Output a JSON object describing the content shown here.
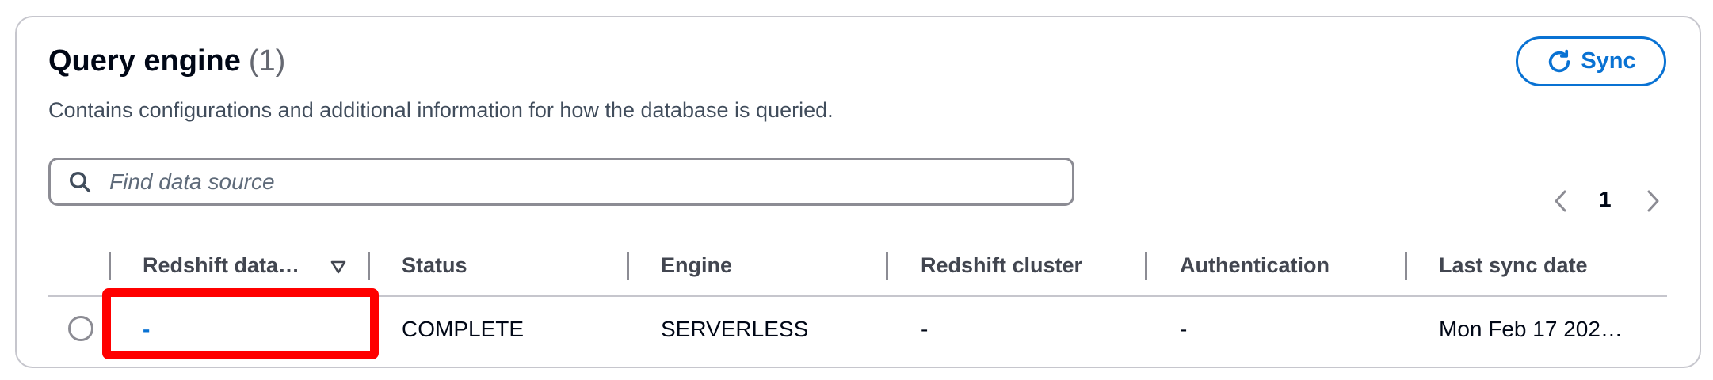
{
  "panel": {
    "title": "Query engine",
    "count": "(1)",
    "description": "Contains configurations and additional information for how the database is queried."
  },
  "sync_button": {
    "label": "Sync",
    "icon": "refresh-icon"
  },
  "search": {
    "placeholder": "Find data source",
    "value": ""
  },
  "pagination": {
    "current_page": "1"
  },
  "table": {
    "columns": [
      {
        "label": "Redshift data…",
        "sortable": true
      },
      {
        "label": "Status"
      },
      {
        "label": "Engine"
      },
      {
        "label": "Redshift cluster"
      },
      {
        "label": "Authentication"
      },
      {
        "label": "Last sync date"
      }
    ],
    "rows": [
      {
        "redshift_data": "-",
        "status": "COMPLETE",
        "engine": "SERVERLESS",
        "redshift_cluster": "-",
        "authentication": "-",
        "last_sync_date": "Mon Feb 17 202…",
        "selected": false
      }
    ]
  },
  "colors": {
    "accent": "#0972d3",
    "highlight": "#ff0000",
    "text": "#000716",
    "muted": "#414d5c"
  }
}
